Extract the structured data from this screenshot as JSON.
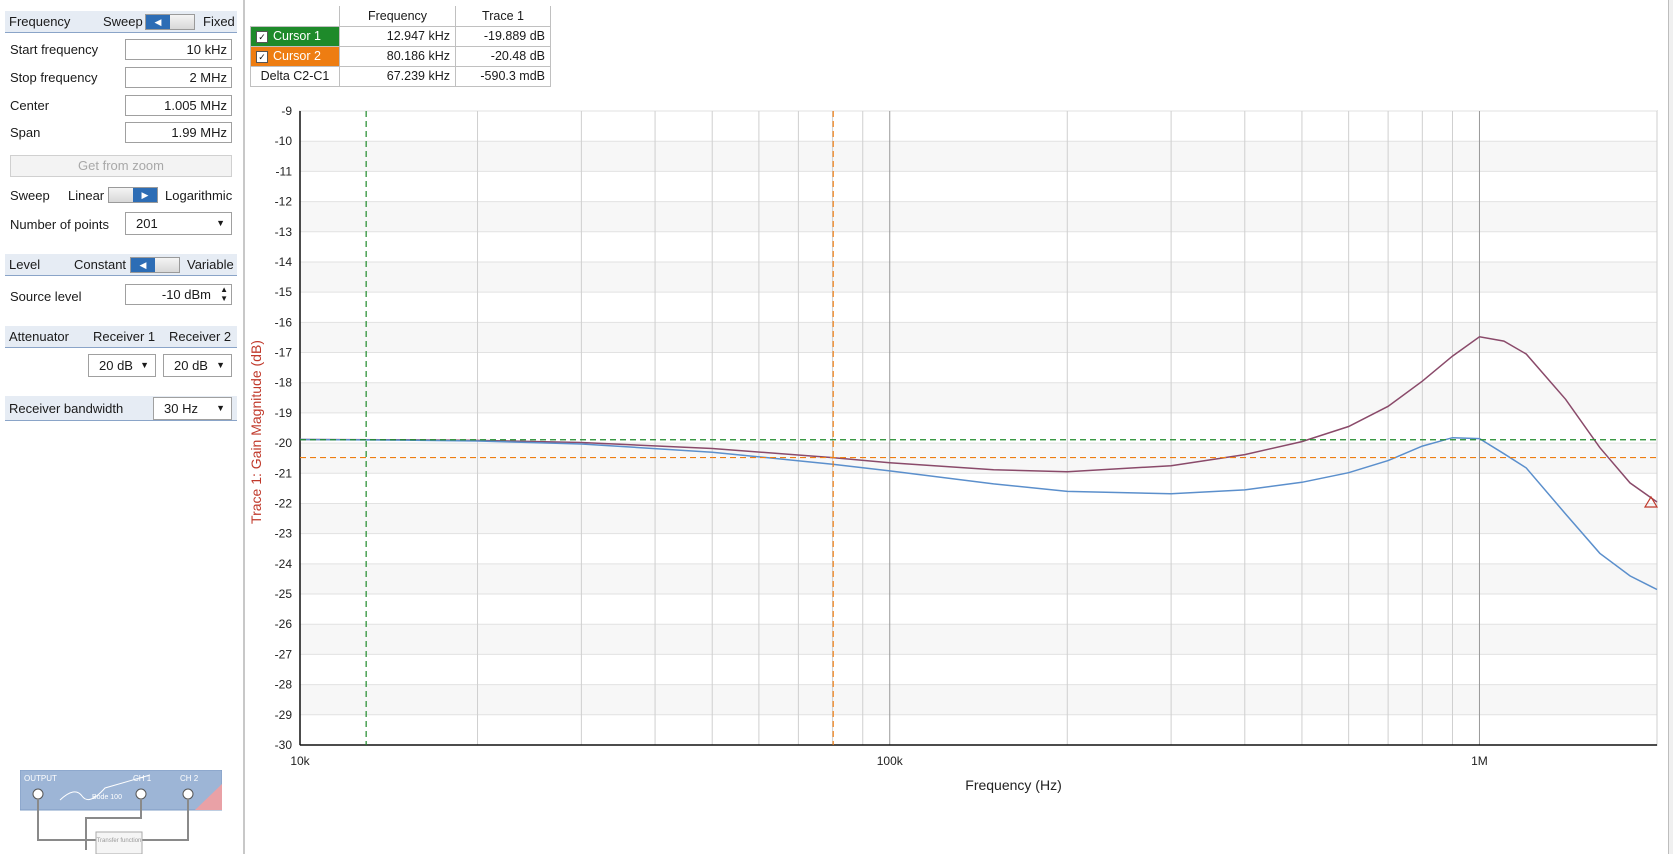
{
  "left": {
    "frequency": {
      "title": "Frequency",
      "opt_left": "Sweep",
      "opt_right": "Fixed",
      "fields": [
        {
          "label": "Start frequency",
          "value": "10 kHz"
        },
        {
          "label": "Stop frequency",
          "value": "2 MHz"
        },
        {
          "label": "Center",
          "value": "1.005 MHz"
        },
        {
          "label": "Span",
          "value": "1.99 MHz"
        }
      ],
      "zoom_button": "Get from zoom",
      "sweep_label": "Sweep",
      "sweep_left": "Linear",
      "sweep_right": "Logarithmic",
      "points_label": "Number of points",
      "points_value": "201"
    },
    "level": {
      "title": "Level",
      "opt_left": "Constant",
      "opt_right": "Variable",
      "source_label": "Source level",
      "source_value": "-10 dBm"
    },
    "attenuator": {
      "title": "Attenuator",
      "col1": "Receiver 1",
      "col2": "Receiver 2",
      "val1": "20 dB",
      "val2": "20 dB"
    },
    "bandwidth": {
      "label": "Receiver bandwidth",
      "value": "30 Hz"
    },
    "schematic": {
      "output": "OUTPUT",
      "ch1": "CH 1",
      "ch2": "CH 2",
      "device": "Bode 100",
      "box": "Transfer function"
    }
  },
  "cursor_table": {
    "headers": [
      "",
      "Frequency",
      "Trace 1"
    ],
    "rows": [
      {
        "name": "Cursor 1",
        "freq": "12.947 kHz",
        "val": "-19.889 dB"
      },
      {
        "name": "Cursor 2",
        "freq": "80.186 kHz",
        "val": "-20.48 dB"
      },
      {
        "name": "Delta C2-C1",
        "freq": "67.239 kHz",
        "val": "-590.3 mdB"
      }
    ]
  },
  "colors": {
    "cursor1": "#1e8a2a",
    "cursor2": "#ee7d12",
    "trace_purple": "#8a4a6a",
    "trace_blue": "#5b8fcc",
    "ylabel": "#c0392b"
  },
  "chart_data": {
    "type": "line",
    "xscale": "log",
    "xlim": [
      10000,
      2000000
    ],
    "ylim": [
      -30,
      -9
    ],
    "ylabel": "Trace 1: Gain Magnitude (dB)",
    "xlabel": "Frequency (Hz)",
    "x_ticks": [
      {
        "v": 10000,
        "label": "10k"
      },
      {
        "v": 100000,
        "label": "100k"
      },
      {
        "v": 1000000,
        "label": "1M"
      }
    ],
    "y_ticks": [
      -9,
      -10,
      -11,
      -12,
      -13,
      -14,
      -15,
      -16,
      -17,
      -18,
      -19,
      -20,
      -21,
      -22,
      -23,
      -24,
      -25,
      -26,
      -27,
      -28,
      -29,
      -30
    ],
    "cursors": [
      {
        "x": 12947,
        "y": -19.889
      },
      {
        "x": 80186,
        "y": -20.48
      }
    ],
    "series": [
      {
        "x": [
          10000,
          15000,
          20000,
          30000,
          50000,
          80000,
          100000,
          150000,
          200000,
          300000,
          400000,
          500000,
          600000,
          700000,
          800000,
          900000,
          1000000,
          1100000,
          1200000,
          1400000,
          1600000,
          1800000,
          2000000
        ],
        "values": [
          -19.88,
          -19.89,
          -19.91,
          -19.98,
          -20.18,
          -20.48,
          -20.65,
          -20.88,
          -20.95,
          -20.75,
          -20.38,
          -19.95,
          -19.45,
          -18.78,
          -17.95,
          -17.12,
          -16.48,
          -16.62,
          -17.05,
          -18.55,
          -20.15,
          -21.32,
          -21.95
        ]
      },
      {
        "x": [
          10000,
          15000,
          20000,
          30000,
          50000,
          80000,
          100000,
          150000,
          200000,
          300000,
          400000,
          500000,
          600000,
          700000,
          800000,
          900000,
          1000000,
          1100000,
          1200000,
          1400000,
          1600000,
          1800000,
          2000000
        ],
        "values": [
          -19.88,
          -19.9,
          -19.93,
          -20.03,
          -20.3,
          -20.7,
          -20.92,
          -21.35,
          -21.6,
          -21.68,
          -21.55,
          -21.3,
          -20.98,
          -20.58,
          -20.1,
          -19.82,
          -19.85,
          -20.35,
          -20.82,
          -22.35,
          -23.65,
          -24.4,
          -24.85
        ]
      }
    ]
  }
}
